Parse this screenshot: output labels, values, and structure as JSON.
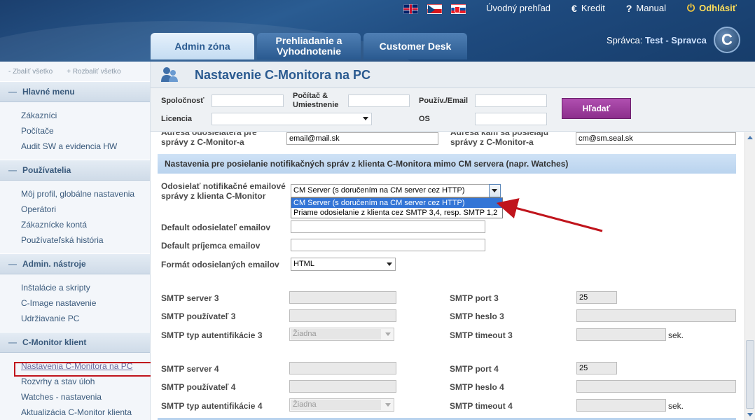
{
  "header": {
    "flags": [
      "uk-flag",
      "cz-flag",
      "sk-flag"
    ],
    "links": [
      {
        "label": "Úvodný prehľad",
        "icon": "home-icon"
      },
      {
        "label": "Kredit",
        "icon": "euro-icon"
      },
      {
        "label": "Manual",
        "icon": "question-icon"
      },
      {
        "label": "Odhlásiť",
        "icon": "power-icon"
      }
    ],
    "tabs": [
      {
        "label": "Admin zóna"
      },
      {
        "label": "Prehliadanie a Vyhodnotenie"
      },
      {
        "label": "Customer Desk"
      }
    ],
    "admin_prefix": "Správca:",
    "admin_name": "Test - Spravca",
    "logo_letter": "C"
  },
  "sidebar": {
    "collapse_all": "- Zbaliť všetko",
    "expand_all": "+ Rozbaliť všetko",
    "sections": [
      {
        "title": "Hlavné menu",
        "items": [
          "Zákazníci",
          "Počítače",
          "Audit SW a evidencia HW"
        ]
      },
      {
        "title": "Používatelia",
        "items": [
          "Môj profil, globálne nastavenia",
          "Operátori",
          "Zákaznícke kontá",
          "Používateľská história"
        ]
      },
      {
        "title": "Admin. nástroje",
        "items": [
          "Inštalácie a skripty",
          "C-Image nastavenie",
          "Udržiavanie PC"
        ]
      },
      {
        "title": "C-Monitor klient",
        "items": [
          "Nastavenia C-Monitora na PC",
          "Rozvrhy a stav úloh",
          "Watches - nastavenia",
          "Aktualizácia C-Monitor klienta"
        ]
      }
    ]
  },
  "main": {
    "title": "Nastavenie C-Monitora na PC",
    "filter": {
      "company": "Spoločnosť",
      "computer": "Počítač & Umiestnenie",
      "user": "Použív./Email",
      "license": "Licencia",
      "os": "OS",
      "search": "Hľadať"
    },
    "top_row": {
      "sender_label": "Adresa odosielateľa pre správy z C-Monitor-a",
      "sender_value": "email@mail.sk",
      "recipient_label": "Adresa kam sa posielajú správy z C-Monitor-a",
      "recipient_value": "cm@sm.seal.sk"
    },
    "section_title": "Nastavenia pre posielanie notifikačných správ z klienta C-Monitora mimo CM servera (napr. Watches)",
    "send_label": "Odosielať notifikačné emailové správy z klienta C-Monitor",
    "send_value": "CM Server (s doručením na CM server cez HTTP)",
    "send_options": [
      "CM Server (s doručením na CM server cez HTTP)",
      "Priame odosielanie z klienta cez SMTP 3,4, resp. SMTP 1,2"
    ],
    "default_sender": "Default odosielateľ emailov",
    "default_recipient": "Default príjemca emailov",
    "format_label": "Formát odosielaných emailov",
    "format_value": "HTML",
    "smtp3": {
      "server": "SMTP server 3",
      "user": "SMTP používateľ 3",
      "auth": "SMTP typ autentifikácie 3",
      "auth_value": "Žiadna",
      "port": "SMTP port 3",
      "port_value": "25",
      "password": "SMTP heslo 3",
      "timeout": "SMTP timeout 3"
    },
    "smtp4": {
      "server": "SMTP server 4",
      "user": "SMTP používateľ 4",
      "auth": "SMTP typ autentifikácie 4",
      "auth_value": "Žiadna",
      "port": "SMTP port 4",
      "port_value": "25",
      "password": "SMTP heslo 4",
      "timeout": "SMTP timeout 4"
    },
    "sec_unit": "sek."
  },
  "colors": {
    "accent": "#2a5a90",
    "highlight": "#c0141c",
    "search_button": "#9c3a9c"
  }
}
